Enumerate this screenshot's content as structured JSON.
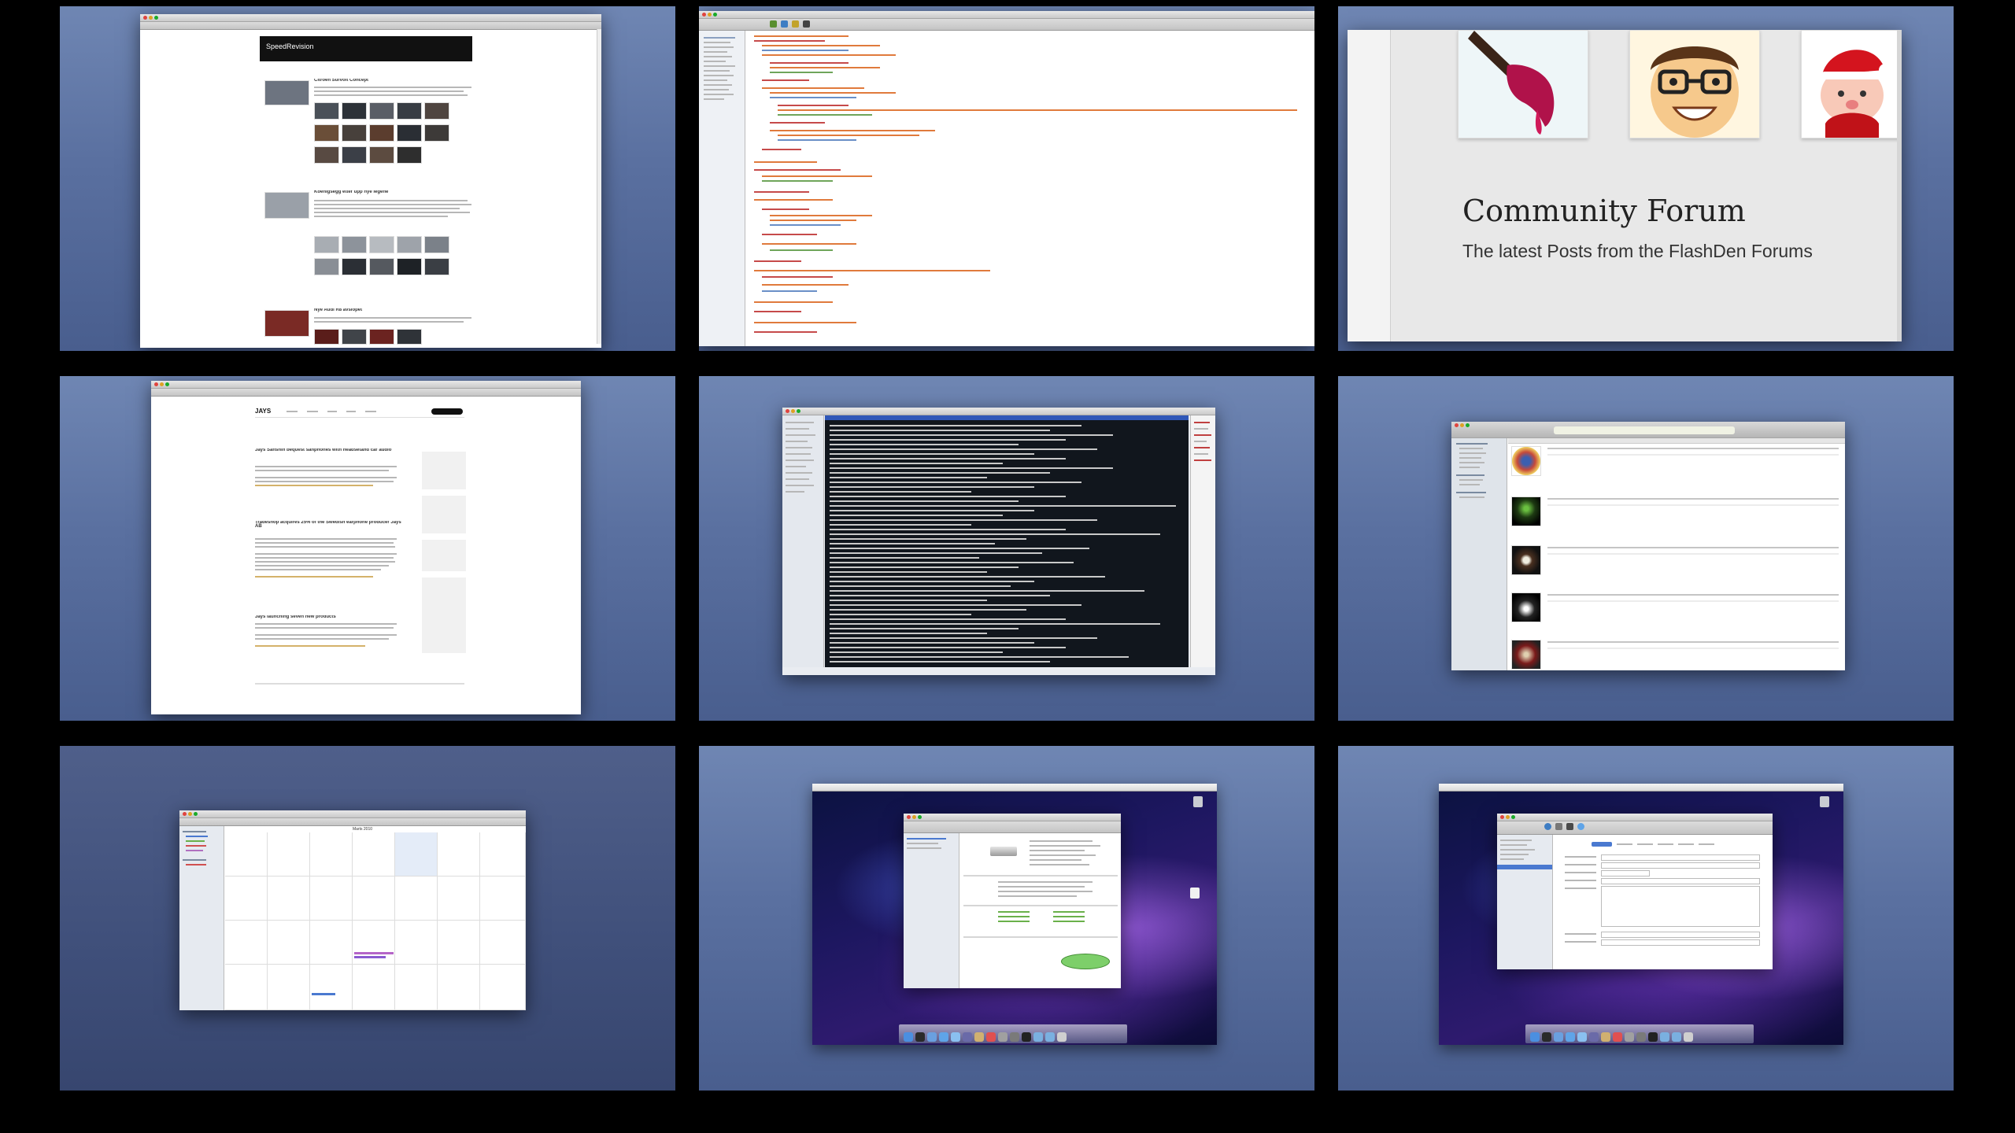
{
  "spaces": [
    {
      "id": 1,
      "app": "Safari",
      "content": {
        "site_title": "SpeedRevision",
        "post_titles": [
          "Citroen Survolt Concept",
          "Koenigsegg etter upp nye legene",
          "Nye Audi R8 avslopet"
        ]
      }
    },
    {
      "id": 2,
      "app": "Code Editor",
      "content": {}
    },
    {
      "id": 3,
      "app": "Browser",
      "content": {
        "heading": "Community Forum",
        "subheading": "The latest Posts from the FlashDen Forums"
      }
    },
    {
      "id": 4,
      "app": "Safari",
      "content": {
        "site_title": "JAYS",
        "post_titles": [
          "Jays Sanshin bequest sanphones with headsetand car audio",
          "Tradeshop acquires 25% of the Swedish earphone producer Jays AB",
          "Jays launching seven new products"
        ]
      }
    },
    {
      "id": 5,
      "app": "Terminal",
      "content": {}
    },
    {
      "id": 6,
      "app": "iTunes",
      "content": {}
    },
    {
      "id": 7,
      "app": "iCal",
      "content": {
        "month_label": "Marts 2010"
      }
    },
    {
      "id": 8,
      "app": "System Profiler",
      "content": {}
    },
    {
      "id": 9,
      "app": "System Preferences",
      "content": {}
    }
  ]
}
